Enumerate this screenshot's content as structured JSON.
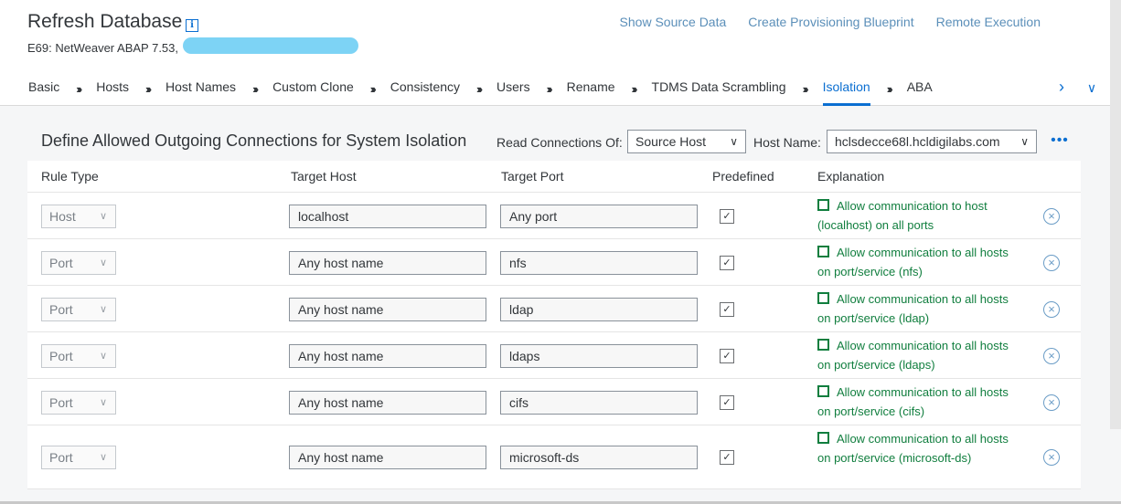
{
  "header": {
    "title": "Refresh Database",
    "subtitle": "E69: NetWeaver ABAP 7.53,",
    "actions": [
      "Show Source Data",
      "Create Provisioning Blueprint",
      "Remote Execution"
    ]
  },
  "tabs": [
    "Basic",
    "Hosts",
    "Host Names",
    "Custom Clone",
    "Consistency",
    "Users",
    "Rename",
    "TDMS Data Scrambling",
    "Isolation",
    "ABA"
  ],
  "active_tab": "Isolation",
  "section": {
    "title": "Define Allowed Outgoing Connections for System Isolation",
    "read_connections_label": "Read Connections Of:",
    "read_connections_value": "Source Host",
    "host_name_label": "Host Name:",
    "host_name_value": "hclsdecce68l.hcldigilabs.com"
  },
  "table": {
    "columns": [
      "Rule Type",
      "Target Host",
      "Target Port",
      "Predefined",
      "Explanation"
    ],
    "rows": [
      {
        "rule_type": "Host",
        "target_host": "localhost",
        "target_port": "Any port",
        "predefined": true,
        "explanation": "Allow communication to host (localhost) on all ports"
      },
      {
        "rule_type": "Port",
        "target_host": "Any host name",
        "target_port": "nfs",
        "predefined": true,
        "explanation": "Allow communication to all hosts on port/service (nfs)"
      },
      {
        "rule_type": "Port",
        "target_host": "Any host name",
        "target_port": "ldap",
        "predefined": true,
        "explanation": "Allow communication to all hosts on port/service (ldap)"
      },
      {
        "rule_type": "Port",
        "target_host": "Any host name",
        "target_port": "ldaps",
        "predefined": true,
        "explanation": "Allow communication to all hosts on port/service (ldaps)"
      },
      {
        "rule_type": "Port",
        "target_host": "Any host name",
        "target_port": "cifs",
        "predefined": true,
        "explanation": "Allow communication to all hosts on port/service (cifs)"
      },
      {
        "rule_type": "Port",
        "target_host": "Any host name",
        "target_port": "microsoft-ds",
        "predefined": true,
        "explanation": "Allow communication to all hosts on port/service (microsoft-ds)"
      }
    ]
  },
  "icons": {
    "info": "info-icon",
    "tab_separator": "double-chevron-right-icon",
    "tab_next": "chevron-right-icon",
    "tab_overflow": "chevron-down-icon",
    "more": "more-icon",
    "delete": "delete-circle-icon",
    "checkmark": "checkmark-icon"
  },
  "colors": {
    "accent": "#0a6ed1",
    "link": "#5b8fb9",
    "positive": "#107e3e"
  }
}
